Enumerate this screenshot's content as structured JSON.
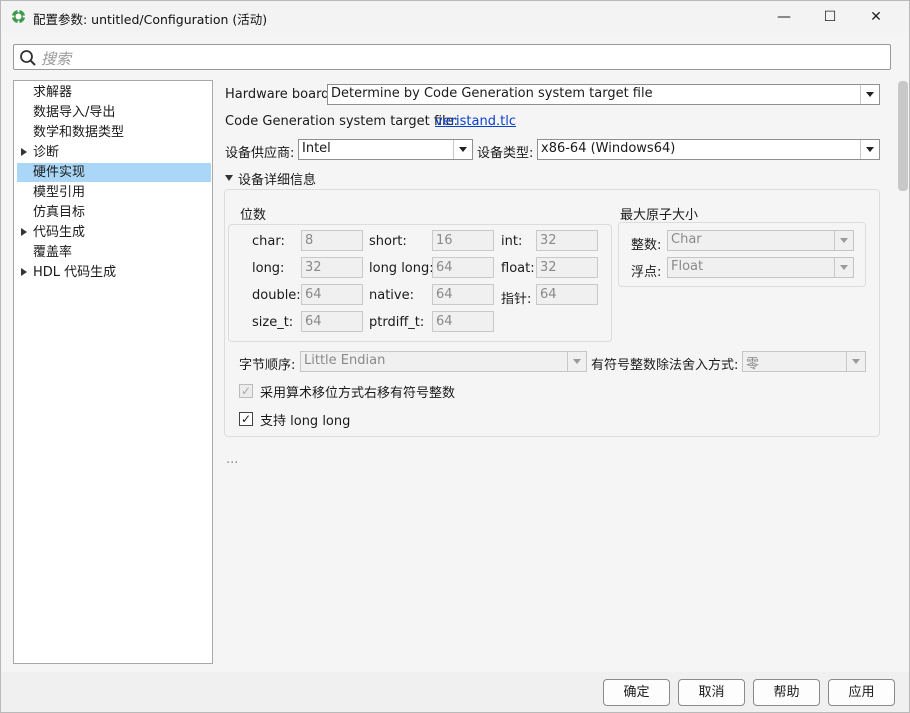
{
  "window": {
    "title": "配置参数: untitled/Configuration (活动)"
  },
  "window_controls": {
    "minimize": "—",
    "maximize": "☐",
    "close": "✕"
  },
  "search": {
    "placeholder": "搜索"
  },
  "sidebar": {
    "items": [
      {
        "label": "求解器",
        "expandable": false,
        "selected": false
      },
      {
        "label": "数据导入/导出",
        "expandable": false,
        "selected": false
      },
      {
        "label": "数学和数据类型",
        "expandable": false,
        "selected": false
      },
      {
        "label": "诊断",
        "expandable": true,
        "selected": false
      },
      {
        "label": "硬件实现",
        "expandable": false,
        "selected": true
      },
      {
        "label": "模型引用",
        "expandable": false,
        "selected": false
      },
      {
        "label": "仿真目标",
        "expandable": false,
        "selected": false
      },
      {
        "label": "代码生成",
        "expandable": true,
        "selected": false
      },
      {
        "label": "覆盖率",
        "expandable": false,
        "selected": false
      },
      {
        "label": "HDL 代码生成",
        "expandable": true,
        "selected": false
      }
    ]
  },
  "hardware": {
    "board_label": "Hardware board:",
    "board_value": "Determine by Code Generation system target file",
    "target_file_label": "Code Generation system target file:",
    "target_file_link": "veristand.tlc",
    "vendor_label": "设备供应商:",
    "vendor_value": "Intel",
    "type_label": "设备类型:",
    "type_value": "x86-64 (Windows64)",
    "details_label": "设备详细信息"
  },
  "bits": {
    "title": "位数",
    "fields": [
      {
        "label": "char:",
        "value": "8"
      },
      {
        "label": "short:",
        "value": "16"
      },
      {
        "label": "int:",
        "value": "32"
      },
      {
        "label": "long:",
        "value": "32"
      },
      {
        "label": "long long:",
        "value": "64"
      },
      {
        "label": "float:",
        "value": "32"
      },
      {
        "label": "double:",
        "value": "64"
      },
      {
        "label": "native:",
        "value": "64"
      },
      {
        "label": "指针:",
        "value": "64"
      },
      {
        "label": "size_t:",
        "value": "64"
      },
      {
        "label": "ptrdiff_t:",
        "value": "64"
      }
    ]
  },
  "atomic": {
    "title": "最大原子大小",
    "integer_label": "整数:",
    "integer_value": "Char",
    "float_label": "浮点:",
    "float_value": "Float"
  },
  "byte_order": {
    "label": "字节顺序:",
    "value": "Little Endian"
  },
  "int_div": {
    "label": "有符号整数除法舍入方式:",
    "value": "零"
  },
  "arith_shift": {
    "label": "采用算术移位方式右移有符号整数",
    "checked": true,
    "enabled": false
  },
  "long_long": {
    "label": "支持 long long",
    "checked": true,
    "enabled": true
  },
  "ellipsis": "...",
  "buttons": {
    "ok": "确定",
    "cancel": "取消",
    "help": "帮助",
    "apply": "应用"
  },
  "colors": {
    "selection": "#aad7f7",
    "link": "#0a3fcf",
    "brand_icon": "#3c9a4a"
  }
}
